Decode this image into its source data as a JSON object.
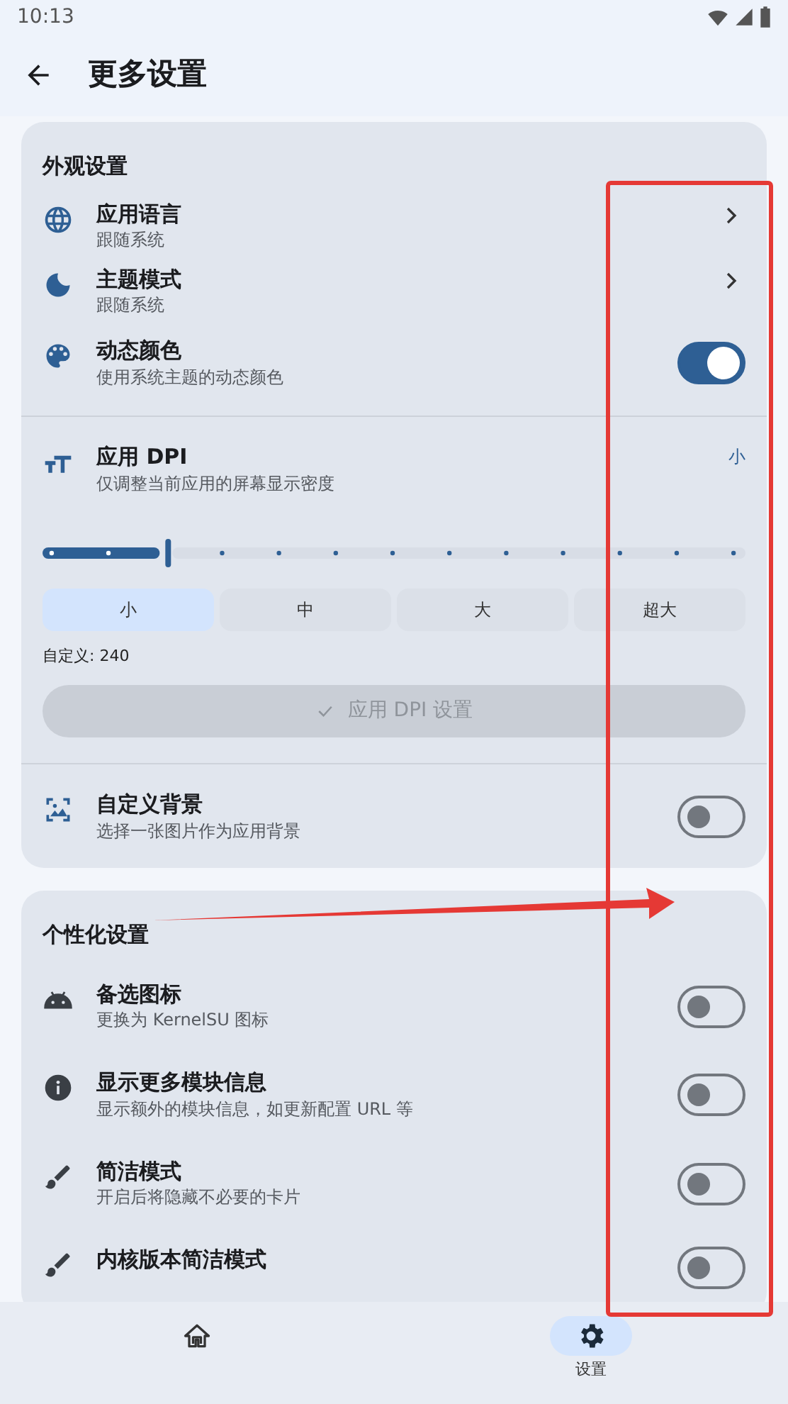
{
  "status_bar": {
    "time": "10:13"
  },
  "app_bar": {
    "title": "更多设置"
  },
  "sections": [
    {
      "title": "外观设置",
      "items": [
        {
          "kind": "link",
          "title": "应用语言",
          "subtitle": "跟随系统"
        },
        {
          "kind": "link",
          "title": "主题模式",
          "subtitle": "跟随系统"
        },
        {
          "kind": "toggle",
          "title": "动态颜色",
          "subtitle": "使用系统主题的动态颜色",
          "on": true
        },
        {
          "kind": "dpi",
          "title": "应用 DPI",
          "subtitle": "仅调整当前应用的屏幕显示密度",
          "value": "小",
          "level": 0.1667,
          "presets": [
            {
              "label": "小",
              "selected": true
            },
            {
              "label": "中",
              "selected": false
            },
            {
              "label": "大",
              "selected": false
            },
            {
              "label": "超大",
              "selected": false
            }
          ],
          "custom": "自定义: 240",
          "apply_button": {
            "label": "应用 DPI 设置",
            "disabled": true
          }
        },
        {
          "kind": "toggle",
          "title": "自定义背景",
          "subtitle": "选择一张图片作为应用背景",
          "on": false
        }
      ]
    },
    {
      "title": "个性化设置",
      "items": [
        {
          "kind": "toggle",
          "title": "备选图标",
          "subtitle": "更换为 KernelSU 图标",
          "on": false
        },
        {
          "kind": "toggle",
          "title": "显示更多模块信息",
          "subtitle": "显示额外的模块信息，如更新配置 URL 等",
          "on": false
        },
        {
          "kind": "toggle",
          "title": "简洁模式",
          "subtitle": "开启后将隐藏不必要的卡片",
          "on": false
        },
        {
          "kind": "toggle",
          "title": "内核版本简洁模式",
          "on": false
        }
      ]
    }
  ],
  "bottom_nav": [
    {
      "selected": false
    },
    {
      "label": "设置",
      "selected": true
    }
  ],
  "highlight_box": {
    "color": "#e53935"
  },
  "annotation_arrow": {
    "color": "#e53935"
  }
}
